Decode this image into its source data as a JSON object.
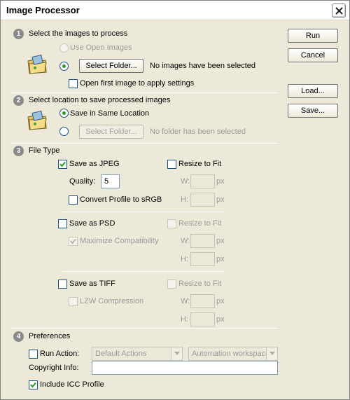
{
  "window": {
    "title": "Image Processor"
  },
  "buttons": {
    "run": "Run",
    "cancel": "Cancel",
    "load": "Load...",
    "save": "Save..."
  },
  "section1": {
    "number": "1",
    "heading": "Select the images to process",
    "use_open_images": "Use Open Images",
    "select_folder": "Select Folder...",
    "status": "No images have been selected",
    "open_first": "Open first image to apply settings"
  },
  "section2": {
    "number": "2",
    "heading": "Select location to save processed images",
    "save_same": "Save in Same Location",
    "select_folder": "Select Folder...",
    "status": "No folder has been selected"
  },
  "section3": {
    "number": "3",
    "heading": "File Type",
    "jpeg": {
      "save_as": "Save as JPEG",
      "resize": "Resize to Fit",
      "quality_label": "Quality:",
      "quality_value": "5",
      "convert_profile": "Convert Profile to sRGB",
      "w": "W:",
      "h": "H:",
      "px": "px"
    },
    "psd": {
      "save_as": "Save as PSD",
      "resize": "Resize to Fit",
      "maximize": "Maximize Compatibility",
      "w": "W:",
      "h": "H:",
      "px": "px"
    },
    "tiff": {
      "save_as": "Save as TIFF",
      "resize": "Resize to Fit",
      "lzw": "LZW Compression",
      "w": "W:",
      "h": "H:",
      "px": "px"
    }
  },
  "section4": {
    "number": "4",
    "heading": "Preferences",
    "run_action": "Run Action:",
    "action_set": "Default Actions",
    "action": "Automation workspaces",
    "copyright_label": "Copyright Info:",
    "copyright_value": "",
    "include_icc": "Include ICC Profile"
  },
  "colors": {
    "radio_dot": "#21a121",
    "check": "#21a121",
    "number_badge": "#8a8a8a"
  }
}
